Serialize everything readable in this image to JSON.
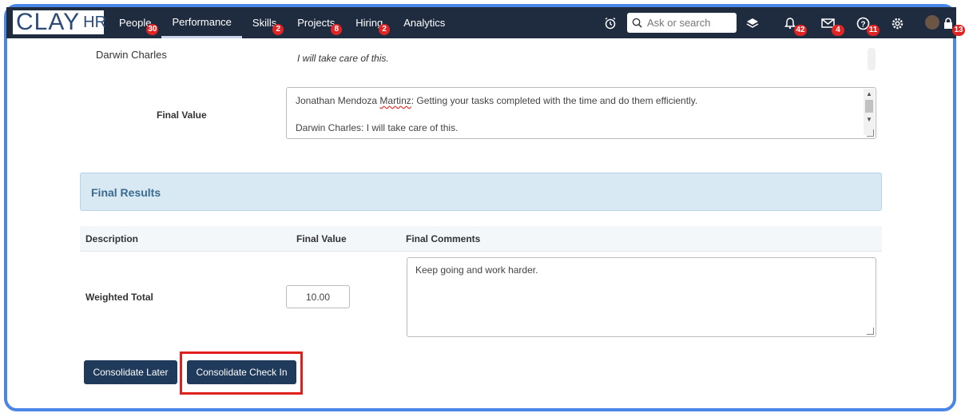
{
  "brand": {
    "logo_main": "CLAY",
    "logo_sub": "HR"
  },
  "nav": [
    {
      "label": "People",
      "badge": "30"
    },
    {
      "label": "Performance",
      "badge": "",
      "active": true
    },
    {
      "label": "Skills",
      "badge": "2"
    },
    {
      "label": "Projects",
      "badge": "8"
    },
    {
      "label": "Hiring",
      "badge": "2"
    },
    {
      "label": "Analytics",
      "badge": ""
    }
  ],
  "toolbar": {
    "search_placeholder": "Ask or search",
    "notifications_badge": "42",
    "messages_badge": "4",
    "help_badge": "11",
    "profile_badge": "13"
  },
  "previous_comment": {
    "name": "Darwin Charles",
    "text": "I will take care of this."
  },
  "final_value": {
    "label": "Final Value",
    "line1_prefix": "Jonathan Mendoza ",
    "line1_misspelled": "Martinz",
    "line1_suffix": ": Getting your tasks completed with the time and do them efficiently.",
    "line2": "Darwin Charles: I will take care of this."
  },
  "final_results": {
    "title": "Final Results",
    "columns": [
      "Description",
      "Final Value",
      "Final Comments"
    ],
    "row_label": "Weighted Total",
    "weighted_value": "10.00",
    "comments": "Keep going and work harder."
  },
  "buttons": {
    "later": "Consolidate Later",
    "checkin": "Consolidate Check In"
  },
  "colors": {
    "topbar": "#1f2c40",
    "button": "#1f3a5a",
    "badge": "#e02424",
    "highlight": "#e0201c",
    "frame": "#4a86e8"
  }
}
